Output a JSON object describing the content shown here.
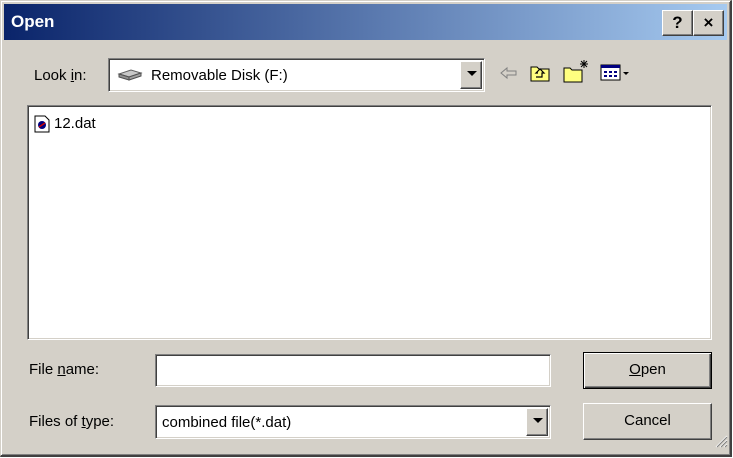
{
  "window": {
    "title": "Open",
    "help_glyph": "?",
    "close_glyph": "×"
  },
  "toolbar": {
    "look_in_label_pre": "Look ",
    "look_in_label_key": "i",
    "look_in_label_post": "n:",
    "look_in_value": "Removable Disk (F:)",
    "drive_icon": "removable-disk-icon",
    "back_icon": "back-arrow-icon",
    "up_icon": "up-one-level-icon",
    "new_folder_icon": "new-folder-icon",
    "views_icon": "view-menu-icon"
  },
  "files": [
    {
      "name": "12.dat",
      "icon": "dat-file-icon"
    }
  ],
  "form": {
    "file_name_label_pre": "File ",
    "file_name_label_key": "n",
    "file_name_label_post": "ame:",
    "file_name_value": "",
    "file_type_label_pre": "Files of ",
    "file_type_label_key": "t",
    "file_type_label_post": "ype:",
    "file_type_value": "combined file(*.dat)"
  },
  "buttons": {
    "open_key": "O",
    "open_rest": "pen",
    "cancel": "Cancel"
  }
}
